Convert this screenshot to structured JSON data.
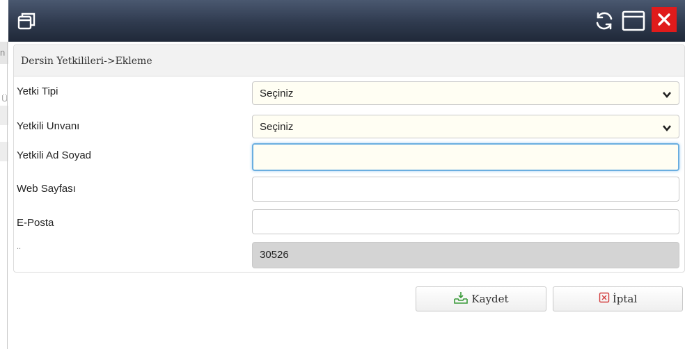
{
  "window": {
    "icons": {
      "app": "restore-window-icon",
      "refresh": "refresh-icon",
      "maximize": "maximize-icon",
      "close": "close-icon"
    }
  },
  "background": {
    "left_char_1": "n",
    "left_char_2": "Ü"
  },
  "panel": {
    "title": "Dersin Yetkilileri->Ekleme",
    "fields": [
      {
        "label": "Yetki Tipi",
        "type": "select",
        "value": "Seçiniz"
      },
      {
        "label": "Yetkili Unvanı",
        "type": "select",
        "value": "Seçiniz"
      },
      {
        "label": "Yetkili Ad Soyad",
        "type": "text",
        "value": ""
      },
      {
        "label": "Web Sayfası",
        "type": "text",
        "value": ""
      },
      {
        "label": "E-Posta",
        "type": "text",
        "value": ""
      },
      {
        "label": "..",
        "type": "readonly",
        "value": "30526"
      }
    ]
  },
  "actions": {
    "save": {
      "label": "Kaydet",
      "icon": "save-tray-icon"
    },
    "cancel": {
      "label": "İptal",
      "icon": "x-box-icon"
    }
  },
  "colors": {
    "close_red": "#e01b1b",
    "titlebar": "#2f3a4e",
    "focus_blue": "#6aaee0",
    "select_bg": "#fffef3"
  }
}
